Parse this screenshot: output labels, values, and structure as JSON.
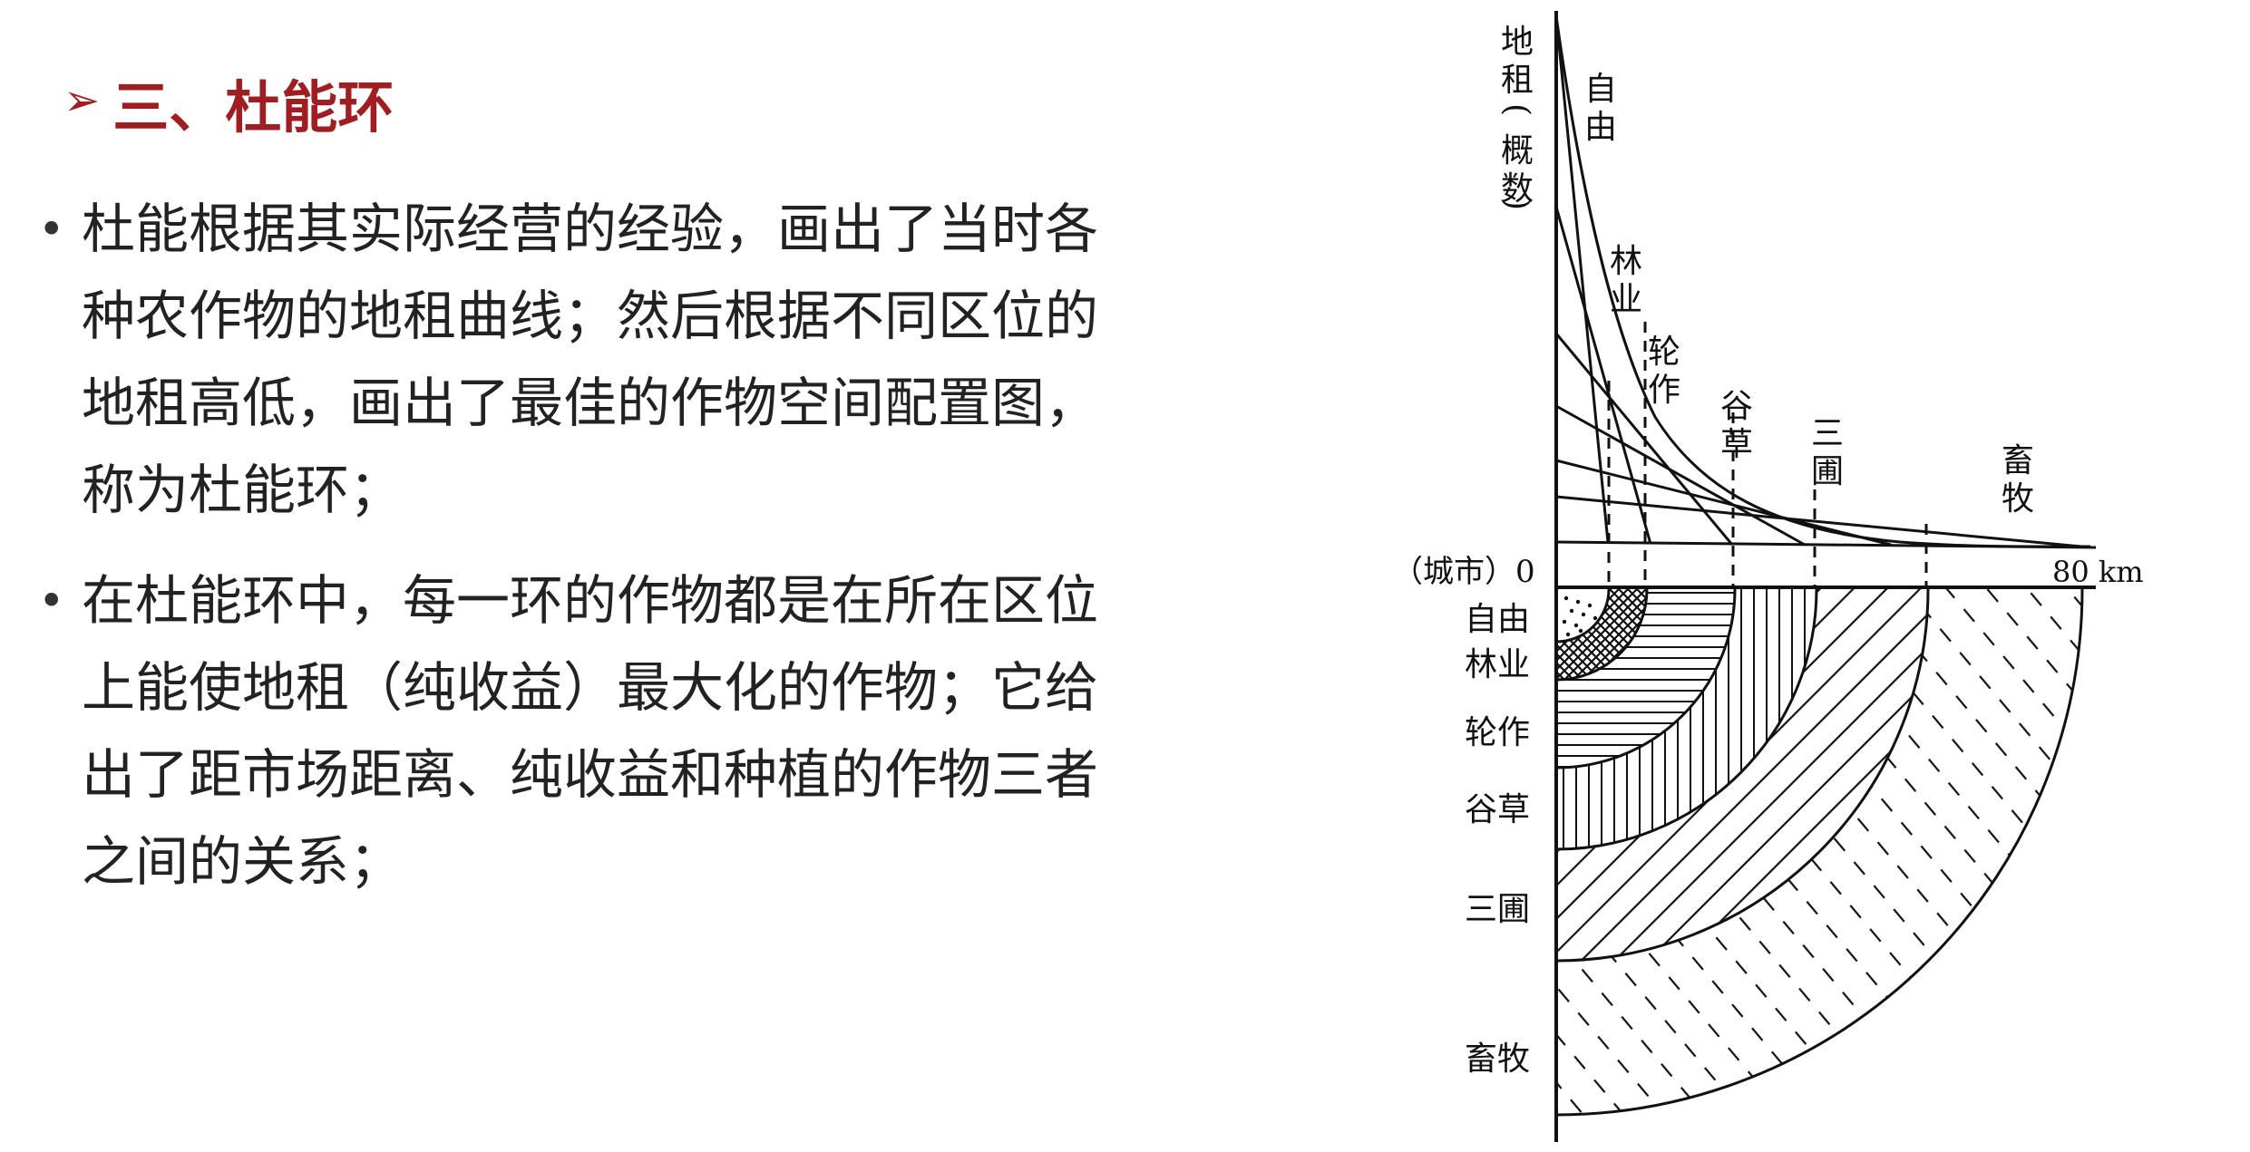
{
  "slide": {
    "title_marker": "➢",
    "title": "三、杜能环",
    "bullets": [
      "杜能根据其实际经营的经验，画出了当时各种农作物的地租曲线；然后根据不同区位的地租高低，画出了最佳的作物空间配置图，称为杜能环；",
      "在杜能环中，每一环的作物都是在所在区位上能使地租（纯收益）最大化的作物；它给出了距市场距离、纯收益和种植的作物三者之间的关系；"
    ]
  },
  "diagram": {
    "y_axis_label": [
      "地",
      "租",
      "(",
      "概",
      "数",
      ")"
    ],
    "origin_label": "（城市）0",
    "distance_label": "80 km",
    "curve_labels": [
      {
        "text": [
          "自",
          "由"
        ]
      },
      {
        "text": [
          "林",
          "业"
        ]
      },
      {
        "text": [
          "轮",
          "作"
        ]
      },
      {
        "text": [
          "谷",
          "草"
        ]
      },
      {
        "text": [
          "三",
          "圃"
        ]
      },
      {
        "text": [
          "畜",
          "牧"
        ]
      }
    ],
    "ring_labels": [
      "自由",
      "林业",
      "轮作",
      "谷草",
      "三圃",
      "畜牧"
    ]
  }
}
